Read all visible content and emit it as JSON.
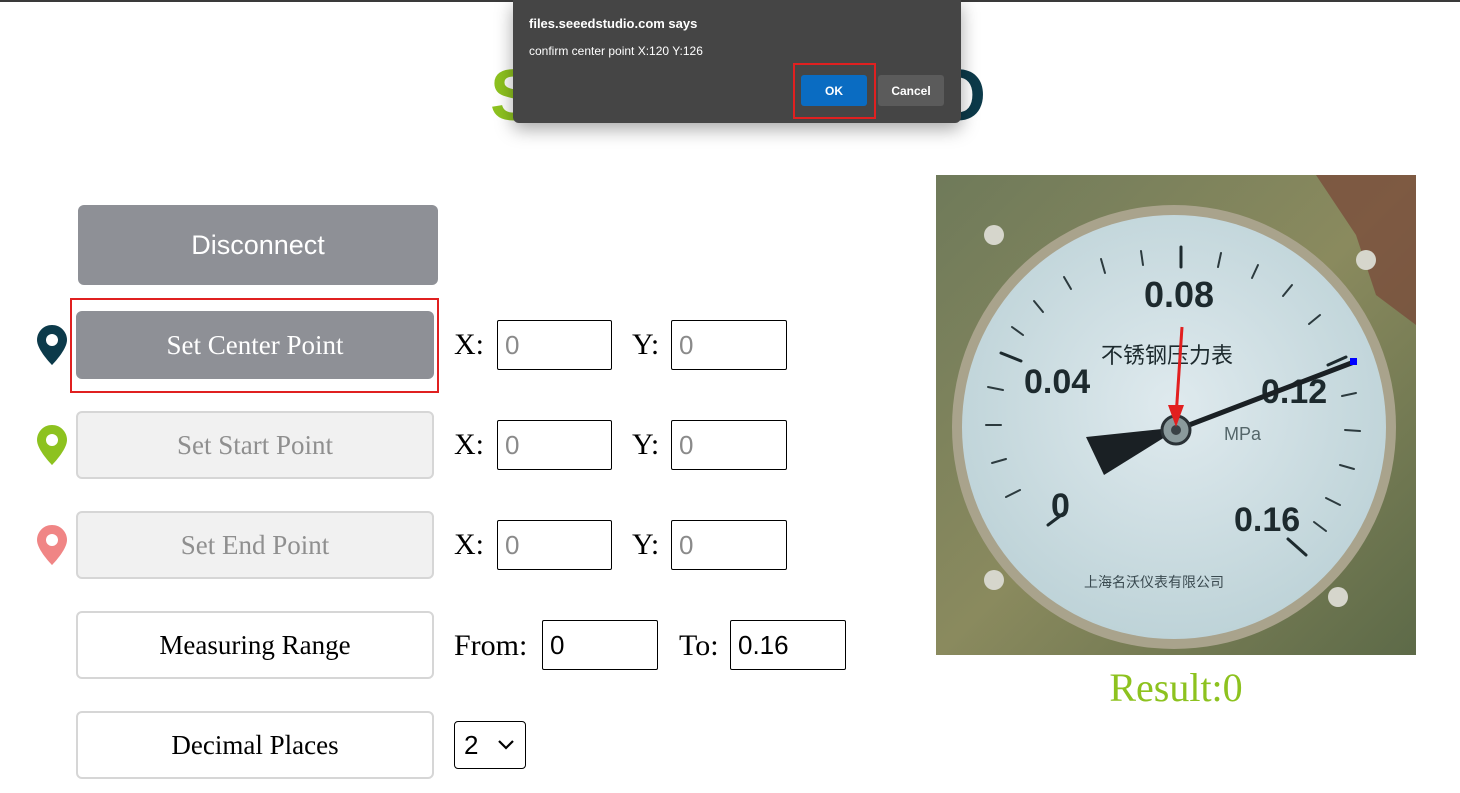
{
  "dialog": {
    "title": "files.seeedstudio.com says",
    "message": "confirm center point X:120 Y:126",
    "ok_label": "OK",
    "cancel_label": "Cancel"
  },
  "logo": {
    "left_letter": "S",
    "right_letter": "O"
  },
  "buttons": {
    "disconnect": "Disconnect",
    "set_center": "Set Center Point",
    "set_start": "Set Start Point",
    "set_end": "Set End Point",
    "measuring_range": "Measuring Range",
    "decimal_places": "Decimal Places"
  },
  "labels": {
    "x": "X:",
    "y": "Y:",
    "from": "From:",
    "to": "To:"
  },
  "center": {
    "x_placeholder": "0",
    "y_placeholder": "0"
  },
  "start": {
    "x_placeholder": "0",
    "y_placeholder": "0"
  },
  "end": {
    "x_placeholder": "0",
    "y_placeholder": "0"
  },
  "range": {
    "from": "0",
    "to": "0.16"
  },
  "decimal": {
    "selected": "2"
  },
  "gauge": {
    "tick_labels": [
      "0.08",
      "0.04",
      "0.12",
      "0",
      "0.16"
    ],
    "title_cn": "不锈钢压力表",
    "unit": "MPa",
    "maker": "上海名沃仪表有限公司"
  },
  "result_text": "Result:0",
  "colors": {
    "accent_green": "#8dc21f",
    "dark_teal": "#0c3a4a",
    "end_pin": "#f08585",
    "highlight_red": "#e02020",
    "ok_blue": "#0a6cc2"
  },
  "icons": {
    "center_pin": "map-pin-icon",
    "start_pin": "map-pin-icon",
    "end_pin": "map-pin-icon",
    "select_chevron": "chevron-down-icon"
  }
}
